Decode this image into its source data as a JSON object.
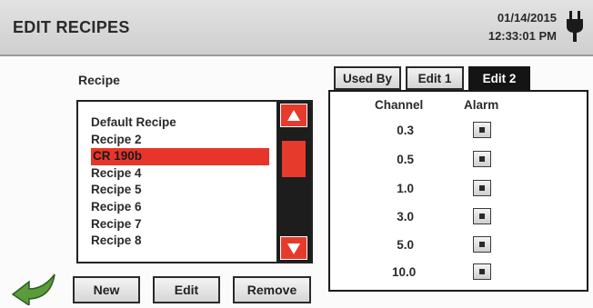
{
  "header": {
    "title": "EDIT RECIPES",
    "date": "01/14/2015",
    "time": "12:33:01 PM"
  },
  "recipe_section": {
    "label": "Recipe",
    "items": [
      {
        "label": "Default Recipe",
        "selected": false
      },
      {
        "label": "Recipe 2",
        "selected": false
      },
      {
        "label": "CR 190b",
        "selected": true
      },
      {
        "label": "Recipe 4",
        "selected": false
      },
      {
        "label": "Recipe 5",
        "selected": false
      },
      {
        "label": "Recipe 6",
        "selected": false
      },
      {
        "label": "Recipe 7",
        "selected": false
      },
      {
        "label": "Recipe 8",
        "selected": false
      }
    ]
  },
  "buttons": {
    "new": "New",
    "edit": "Edit",
    "remove": "Remove"
  },
  "tabs": [
    {
      "label": "Used By",
      "active": false
    },
    {
      "label": "Edit 1",
      "active": false
    },
    {
      "label": "Edit 2",
      "active": true
    }
  ],
  "channel_table": {
    "headers": {
      "channel": "Channel",
      "alarm": "Alarm"
    },
    "rows": [
      {
        "channel": "0.3",
        "alarm": false
      },
      {
        "channel": "0.5",
        "alarm": false
      },
      {
        "channel": "1.0",
        "alarm": false
      },
      {
        "channel": "3.0",
        "alarm": false
      },
      {
        "channel": "5.0",
        "alarm": false
      },
      {
        "channel": "10.0",
        "alarm": false
      }
    ]
  },
  "colors": {
    "accent_red": "#e63b2c",
    "selected_row": "#e8352a",
    "active_tab": "#141414",
    "back_arrow": "#4a8a32"
  },
  "icons": {
    "power": "power-plug-icon",
    "back": "back-arrow-icon",
    "scroll_up": "scroll-up-arrow-icon",
    "scroll_down": "scroll-down-arrow-icon"
  }
}
